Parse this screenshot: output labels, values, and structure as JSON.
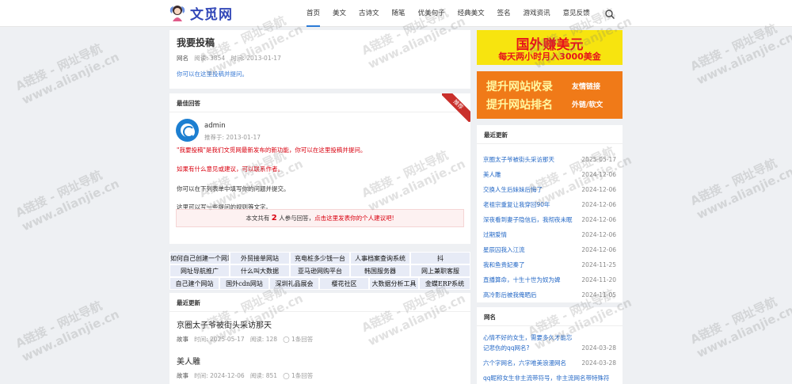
{
  "site": {
    "logo_text": "文觅网"
  },
  "nav": [
    "首页",
    "美文",
    "古诗文",
    "随笔",
    "优美句子",
    "经典美文",
    "签名",
    "游戏资讯",
    "意见反馈"
  ],
  "question": {
    "title": "我要投稿",
    "cat_label": "网名",
    "views_label": "阅读:",
    "views": "3854",
    "date_label": "时间:",
    "date": "2013-01-17",
    "desc": "你可以在这里投稿并提问。"
  },
  "best_answer": {
    "heading": "最佳回答",
    "user": "admin",
    "time": "推荐于: 2013-01-17",
    "ribbon": "推荐",
    "p1": "\"我要投稿\"是我们文觅网最新发布的新功能，你可以在这里投稿并提问。",
    "p2": "如果有什么意见或建议，可以联系作者。",
    "p3": "你可以在下列表单中填写你的问题并提交。",
    "p4": "这里可以写一些提问的规则等文字。",
    "summary_prefix": "本文共有",
    "summary_count": "2",
    "summary_mid": "人参与回答，",
    "summary_link": "点击这里发表你的个人建议吧!"
  },
  "link_grid": [
    "如何自己创建一个网站",
    "外贸接单网站",
    "充电桩多少钱一台",
    "人事档案查询系统",
    "抖",
    "网址导航推广",
    "什么叫大数据",
    "亚马逊网购平台",
    "韩国服务器",
    "网上兼职客服",
    "自己建个网站",
    "国外cdn网站",
    "深圳礼品展会",
    "樱花社区",
    "大数据分析工具",
    "金蝶ERP系统"
  ],
  "recent_main": {
    "heading": "最近更新",
    "items": [
      {
        "title": "京圈太子爷被街头采访那天",
        "cat": "故事",
        "time": "时间: 2025-05-17",
        "views": "阅读: 128",
        "answers": "1条回答"
      },
      {
        "title": "美人雕",
        "cat": "故事",
        "time": "时间: 2024-12-06",
        "views": "阅读: 851",
        "answers": "1条回答"
      }
    ]
  },
  "ads": {
    "ad1_line1": "国外赚美元",
    "ad1_line2": "每天两小时月入3000美金",
    "ad2_a1": "提升网站收录",
    "ad2_a2": "提升网站排名",
    "ad2_b1": "友情链接",
    "ad2_b2": "外链/软文"
  },
  "recent_side": {
    "heading": "最近更新",
    "items": [
      {
        "title": "京圈太子爷被街头采访那天",
        "date": "2025-05-17"
      },
      {
        "title": "美人雕",
        "date": "2024-12-06"
      },
      {
        "title": "交换人生后妹妹后悔了",
        "date": "2024-12-06"
      },
      {
        "title": "老祖宗重复让我穿回90年",
        "date": "2024-12-06"
      },
      {
        "title": "深夜看到妻子隐信后，我彻夜未眠",
        "date": "2024-12-06"
      },
      {
        "title": "过期爱情",
        "date": "2024-12-06"
      },
      {
        "title": "星辰囚我入江流",
        "date": "2024-12-06"
      },
      {
        "title": "我和鱼贵妃秦了",
        "date": "2024-11-25"
      },
      {
        "title": "直播算命，十生十世为奴为婢",
        "date": "2024-11-20"
      },
      {
        "title": "高冷影后被我俺晒后",
        "date": "2024-11-05"
      }
    ]
  },
  "names_side": {
    "heading": "网名",
    "items": [
      {
        "title": "心情不好的女生，需要多久才能忘记悲伤的qq网名?",
        "date": "2024-03-28"
      },
      {
        "title": "六个字网名，六字唯美浪漫网名",
        "date": "2024-03-28"
      },
      {
        "title": "qq昵称女生非主流带符号，非主流网名带特殊符",
        "date": ""
      }
    ]
  },
  "watermark": {
    "line1": "A链接 - 网址导航",
    "line2": "www.alianjie.cn"
  }
}
